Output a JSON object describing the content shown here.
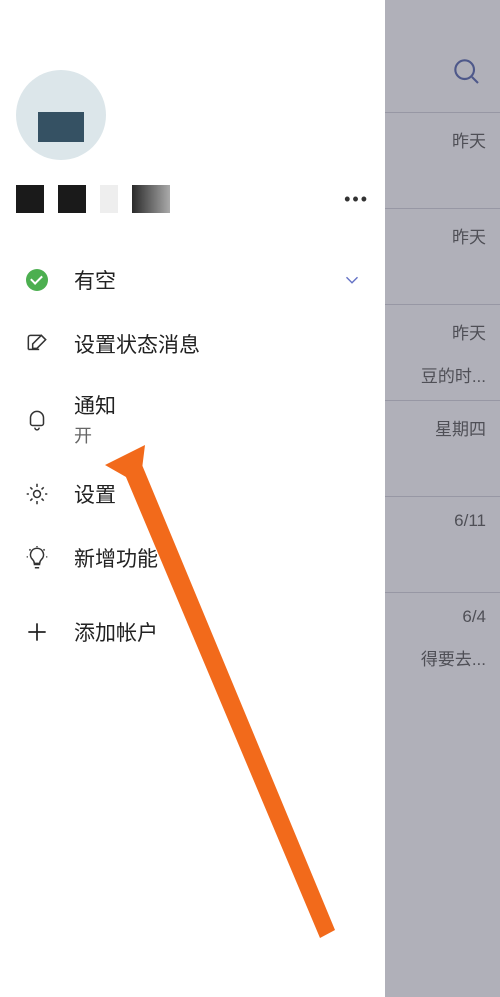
{
  "drawer": {
    "status": {
      "label": "有空"
    },
    "setStatus": {
      "label": "设置状态消息"
    },
    "notifications": {
      "label": "通知",
      "sub": "开"
    },
    "settings": {
      "label": "设置"
    },
    "whatsNew": {
      "label": "新增功能"
    },
    "addAccount": {
      "label": "添加帐户"
    }
  },
  "chatlist": {
    "r1": {
      "date": "昨天"
    },
    "r2": {
      "date": "昨天"
    },
    "r3": {
      "date": "昨天",
      "sub": "豆的时..."
    },
    "r4": {
      "date": "星期四"
    },
    "r5": {
      "date": "6/11"
    },
    "r6": {
      "date": "6/4",
      "sub": "得要去..."
    }
  }
}
